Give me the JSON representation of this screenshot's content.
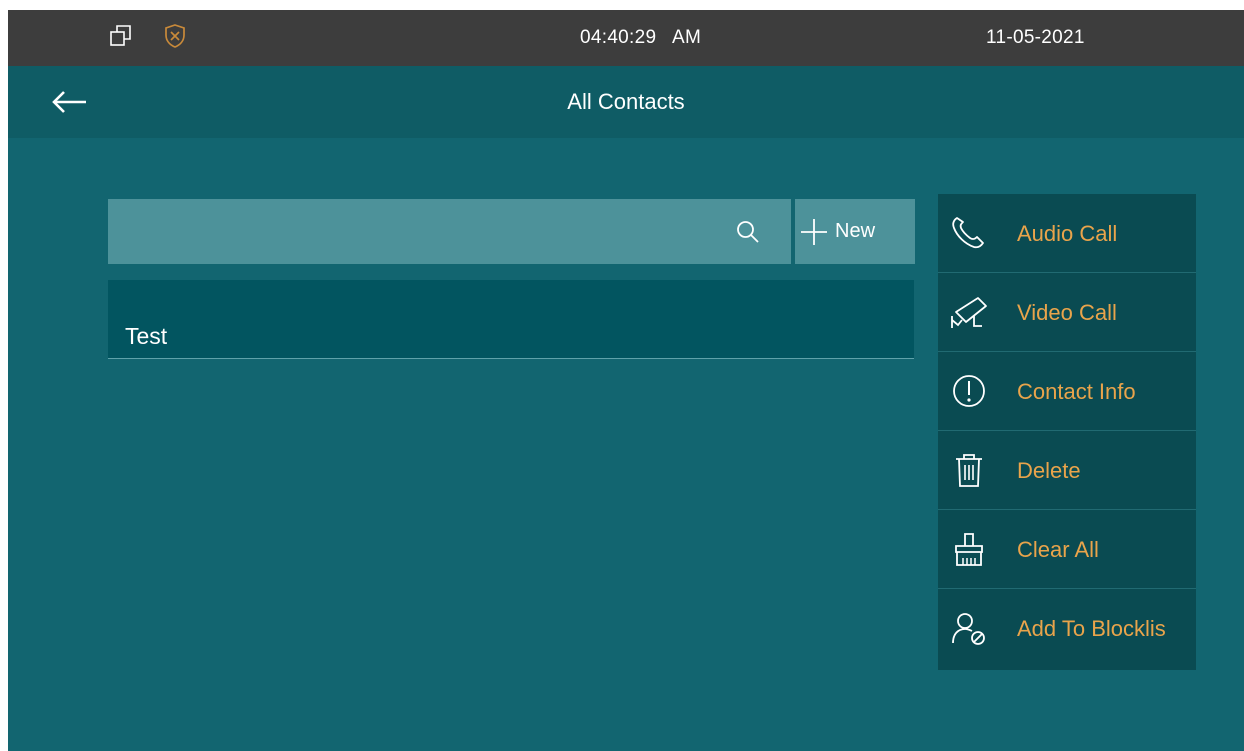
{
  "status_bar": {
    "icons": [
      "window-restore-icon",
      "shield-x-icon"
    ],
    "time": "04:40:29   AM",
    "date": "11-05-2021"
  },
  "header": {
    "back_icon": "arrow-left-icon",
    "title": "All Contacts"
  },
  "search": {
    "value": "",
    "icon": "search-icon"
  },
  "new_button": {
    "icon": "plus-icon",
    "label": "New"
  },
  "contacts": [
    {
      "name": "Test"
    }
  ],
  "actions": [
    {
      "icon": "phone-icon",
      "label": "Audio Call"
    },
    {
      "icon": "camera-icon",
      "label": "Video Call"
    },
    {
      "icon": "info-icon",
      "label": "Contact Info"
    },
    {
      "icon": "trash-icon",
      "label": "Delete"
    },
    {
      "icon": "broom-icon",
      "label": "Clear All"
    },
    {
      "icon": "block-user-icon",
      "label": "Add To Blocklis"
    }
  ],
  "colors": {
    "background": "#126570",
    "status_bar": "#3d3d3d",
    "title_bar": "#0f5c65",
    "search_fill": "#4d929a",
    "contact_row": "#025560",
    "menu_bg": "#0a4b52",
    "action_label": "#e9a44b",
    "shield_accent": "#c98a3a"
  }
}
